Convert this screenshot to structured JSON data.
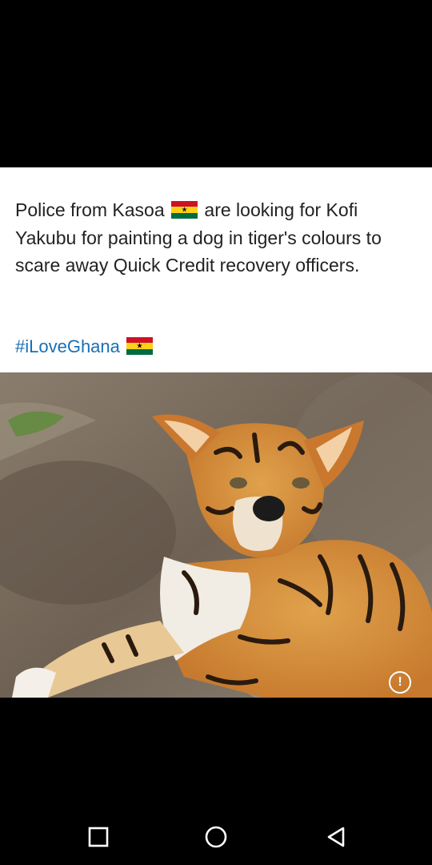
{
  "post": {
    "caption_part1": "Police from Kasoa",
    "caption_part2": "are looking for Kofi Yakubu for painting a dog in tiger's colours to scare away Quick Credit recovery officers.",
    "hashtag": "#iLoveGhana",
    "photo_icon": "dog-painted-as-tiger-photo"
  },
  "flag": {
    "name": "ghana-flag-icon",
    "red": "#ce1126",
    "yellow": "#fcd116",
    "green": "#006b3f",
    "star": "#000000"
  },
  "overlay": {
    "info_icon": "info-icon",
    "info_glyph": "!"
  },
  "nav": {
    "recents_icon": "square-recents-icon",
    "home_icon": "circle-home-icon",
    "back_icon": "triangle-back-icon"
  }
}
